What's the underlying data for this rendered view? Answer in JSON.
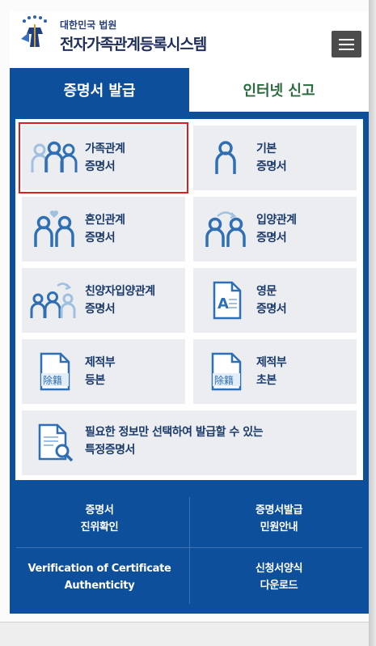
{
  "header": {
    "org_name": "대한민국 법원",
    "system_name": "전자가족관계등록시스템"
  },
  "tabs": [
    {
      "label": "증명서 발급",
      "active": true
    },
    {
      "label": "인터넷 신고",
      "active": false
    }
  ],
  "cards": [
    {
      "line1": "가족관계",
      "line2": "증명서",
      "icon": "three-people-icon",
      "highlighted": true
    },
    {
      "line1": "기본",
      "line2": "증명서",
      "icon": "single-person-icon",
      "highlighted": false
    },
    {
      "line1": "혼인관계",
      "line2": "증명서",
      "icon": "couple-heart-icon",
      "highlighted": false
    },
    {
      "line1": "입양관계",
      "line2": "증명서",
      "icon": "adoption-icon",
      "highlighted": false
    },
    {
      "line1": "친양자입양관계",
      "line2": "증명서",
      "icon": "full-adoption-icon",
      "highlighted": false
    },
    {
      "line1": "영문",
      "line2": "증명서",
      "icon": "english-document-icon",
      "highlighted": false
    },
    {
      "line1": "제적부",
      "line2": "등본",
      "icon": "removed-register-copy-icon",
      "icon_text": "除籍",
      "highlighted": false
    },
    {
      "line1": "제적부",
      "line2": "초본",
      "icon": "removed-register-extract-icon",
      "icon_text": "除籍",
      "highlighted": false
    },
    {
      "line1": "필요한 정보만 선택하여 발급할 수 있는",
      "line2": "특정증명서",
      "icon": "document-search-icon",
      "highlighted": false
    }
  ],
  "bottom_links": [
    {
      "line1": "증명서",
      "line2": "진위확인"
    },
    {
      "line1": "증명서발급",
      "line2": "민원안내"
    },
    {
      "line1": "Verification of Certificate",
      "line2": "Authenticity"
    },
    {
      "line1": "신청서양식",
      "line2": "다운로드"
    }
  ],
  "colors": {
    "panel_blue": "#0d4f9a",
    "card_bg": "#ebedf1",
    "highlight_red": "#e21b1b",
    "inactive_tab_text": "#2a6b3e",
    "icon_blue": "#2f6fb3",
    "icon_light": "#9fc0e0"
  }
}
